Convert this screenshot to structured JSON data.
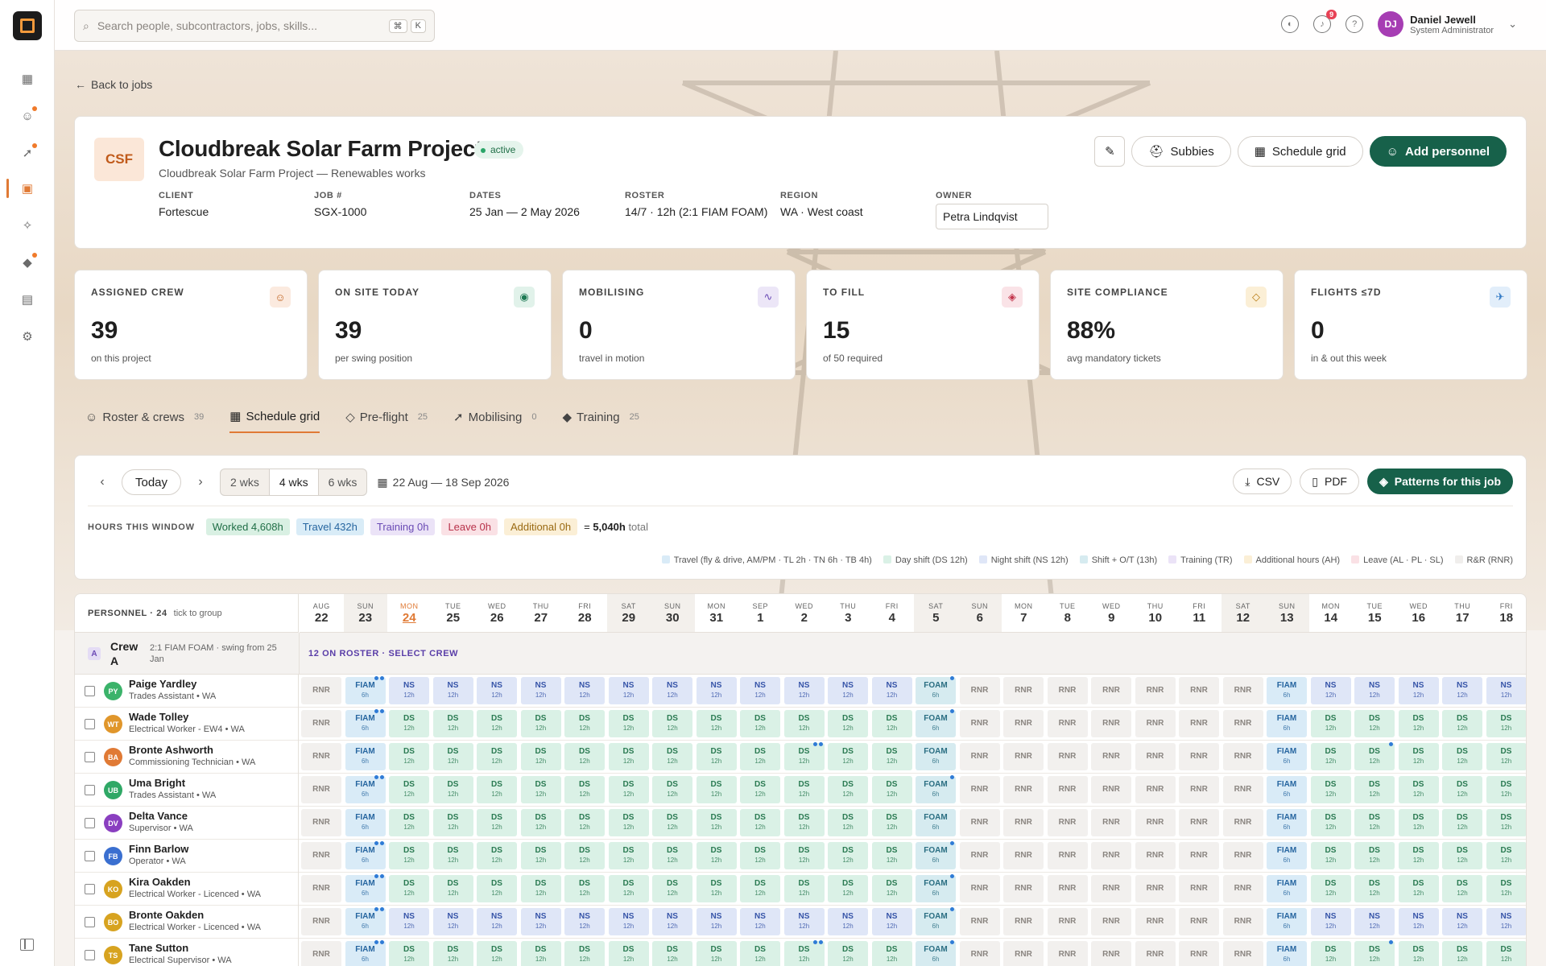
{
  "search": {
    "placeholder": "Search people, subcontractors, jobs, skills...",
    "shortcut": [
      "⌘",
      "K"
    ]
  },
  "topbar": {
    "notifications_count": "9",
    "user": {
      "initials": "DJ",
      "name": "Daniel Jewell",
      "role": "System Administrator"
    }
  },
  "back_label": "Back to jobs",
  "job": {
    "code": "CSF",
    "title": "Cloudbreak Solar Farm Project",
    "status": "active",
    "subtitle": "Cloudbreak Solar Farm Project — Renewables works",
    "meta": [
      {
        "label": "CLIENT",
        "value": "Fortescue"
      },
      {
        "label": "JOB #",
        "value": "SGX-1000"
      },
      {
        "label": "DATES",
        "value": "25 Jan — 2 May 2026"
      },
      {
        "label": "ROSTER",
        "value": "14/7 · 12h (2:1 FIAM FOAM)"
      },
      {
        "label": "REGION",
        "value": "WA · West coast"
      }
    ],
    "owner_label": "OWNER",
    "owner_value": "Petra Lindqvist",
    "buttons": {
      "subbies": "Subbies",
      "schedule": "Schedule grid",
      "add": "Add personnel"
    }
  },
  "stats": [
    {
      "label": "ASSIGNED CREW",
      "value": "39",
      "sub": "on this project",
      "icon": "users-icon",
      "color": "#c0621f",
      "bg": "#fbeadf"
    },
    {
      "label": "ON SITE TODAY",
      "value": "39",
      "sub": "per swing position",
      "icon": "pin-icon",
      "color": "#1f7a55",
      "bg": "#e1f2ea"
    },
    {
      "label": "MOBILISING",
      "value": "0",
      "sub": "travel in motion",
      "icon": "activity-icon",
      "color": "#6a4bb5",
      "bg": "#ece6f7"
    },
    {
      "label": "TO FILL",
      "value": "15",
      "sub": "of 50 required",
      "icon": "layers-icon",
      "color": "#c2334a",
      "bg": "#fae3e7"
    },
    {
      "label": "SITE COMPLIANCE",
      "value": "88%",
      "sub": "avg mandatory tickets",
      "icon": "shield-icon",
      "color": "#b77b12",
      "bg": "#fbefd6"
    },
    {
      "label": "FLIGHTS ≤7D",
      "value": "0",
      "sub": "in & out this week",
      "icon": "plane-icon",
      "color": "#2f78c4",
      "bg": "#e2eefa"
    }
  ],
  "tabs": [
    {
      "label": "Roster & crews",
      "count": "39"
    },
    {
      "label": "Schedule grid",
      "count": ""
    },
    {
      "label": "Pre-flight",
      "count": "25"
    },
    {
      "label": "Mobilising",
      "count": "0"
    },
    {
      "label": "Training",
      "count": "25"
    }
  ],
  "grid_controls": {
    "today": "Today",
    "ranges": [
      "2 wks",
      "4 wks",
      "6 wks"
    ],
    "active_range": "4 wks",
    "date_range": "22 Aug — 18 Sep 2026",
    "csv": "CSV",
    "pdf": "PDF",
    "patterns": "Patterns for this job"
  },
  "hours": {
    "label": "HOURS THIS WINDOW",
    "chips": [
      {
        "text": "Worked 4,608h",
        "bg": "#d9f0e3",
        "color": "#1f6e46"
      },
      {
        "text": "Travel 432h",
        "bg": "#d9ecf7",
        "color": "#2766a0"
      },
      {
        "text": "Training 0h",
        "bg": "#ebe3f7",
        "color": "#6a4bb5"
      },
      {
        "text": "Leave 0h",
        "bg": "#fae1e5",
        "color": "#b8324a"
      },
      {
        "text": "Additional 0h",
        "bg": "#fbefd6",
        "color": "#9a6a12"
      }
    ],
    "total": "5,040h",
    "total_suffix": "total"
  },
  "legend": [
    {
      "text": "Travel (fly & drive, AM/PM · TL 2h · TN 6h · TB 4h)",
      "color": "#d9ebf7"
    },
    {
      "text": "Day shift (DS 12h)",
      "color": "#daf1e6"
    },
    {
      "text": "Night shift (NS 12h)",
      "color": "#dfe6f7"
    },
    {
      "text": "Shift + O/T (13h)",
      "color": "#d6ebf0"
    },
    {
      "text": "Training (TR)",
      "color": "#ebe3f7"
    },
    {
      "text": "Additional hours (AH)",
      "color": "#fbefd6"
    },
    {
      "text": "Leave (AL · PL · SL)",
      "color": "#fae1e5"
    },
    {
      "text": "R&R (RNR)",
      "color": "#f0eeec"
    }
  ],
  "schedule": {
    "personnel_label": "PERSONNEL · 24",
    "group_hint": "tick to group",
    "days": [
      {
        "w": "AUG",
        "d": "22"
      },
      {
        "w": "SUN",
        "d": "23"
      },
      {
        "w": "MON",
        "d": "24"
      },
      {
        "w": "TUE",
        "d": "25"
      },
      {
        "w": "WED",
        "d": "26"
      },
      {
        "w": "THU",
        "d": "27"
      },
      {
        "w": "FRI",
        "d": "28"
      },
      {
        "w": "SAT",
        "d": "29"
      },
      {
        "w": "SUN",
        "d": "30"
      },
      {
        "w": "MON",
        "d": "31"
      },
      {
        "w": "SEP",
        "d": "1"
      },
      {
        "w": "WED",
        "d": "2"
      },
      {
        "w": "THU",
        "d": "3"
      },
      {
        "w": "FRI",
        "d": "4"
      },
      {
        "w": "SAT",
        "d": "5"
      },
      {
        "w": "SUN",
        "d": "6"
      },
      {
        "w": "MON",
        "d": "7"
      },
      {
        "w": "TUE",
        "d": "8"
      },
      {
        "w": "WED",
        "d": "9"
      },
      {
        "w": "THU",
        "d": "10"
      },
      {
        "w": "FRI",
        "d": "11"
      },
      {
        "w": "SAT",
        "d": "12"
      },
      {
        "w": "SUN",
        "d": "13"
      },
      {
        "w": "MON",
        "d": "14"
      },
      {
        "w": "TUE",
        "d": "15"
      },
      {
        "w": "WED",
        "d": "16"
      },
      {
        "w": "THU",
        "d": "17"
      },
      {
        "w": "FRI",
        "d": "18"
      }
    ],
    "crew": {
      "tag": "A",
      "name": "Crew A",
      "desc": "2:1 FIAM FOAM · swing from 25 Jan",
      "select": "12 ON ROSTER · SELECT CREW"
    },
    "people": [
      {
        "initials": "PY",
        "name": "Paige Yardley",
        "role": "Trades Assistant • WA",
        "color": "#3bb36a",
        "pattern": "ns"
      },
      {
        "initials": "WT",
        "name": "Wade Tolley",
        "role": "Electrical Worker - EW4 • WA",
        "color": "#e0962b",
        "pattern": "ds"
      },
      {
        "initials": "BA",
        "name": "Bronte Ashworth",
        "role": "Commissioning Technician • WA",
        "color": "#e07a35",
        "pattern": "ds"
      },
      {
        "initials": "UB",
        "name": "Uma Bright",
        "role": "Trades Assistant • WA",
        "color": "#2fa866",
        "pattern": "ds"
      },
      {
        "initials": "DV",
        "name": "Delta Vance",
        "role": "Supervisor • WA",
        "color": "#8a3fc0",
        "pattern": "ds"
      },
      {
        "initials": "FB",
        "name": "Finn Barlow",
        "role": "Operator • WA",
        "color": "#3a6fd0",
        "pattern": "ds"
      },
      {
        "initials": "KO",
        "name": "Kira Oakden",
        "role": "Electrical Worker - Licenced • WA",
        "color": "#d7a320",
        "pattern": "ds"
      },
      {
        "initials": "BO",
        "name": "Bronte Oakden",
        "role": "Electrical Worker - Licenced • WA",
        "color": "#d7a320",
        "pattern": "ns"
      },
      {
        "initials": "TS",
        "name": "Tane Sutton",
        "role": "Electrical Supervisor • WA",
        "color": "#d7a320",
        "pattern": "ds"
      }
    ],
    "cell_text": {
      "rnr": "RNR",
      "fiam": "FIAM",
      "foam": "FOAM",
      "ds": "DS",
      "ns": "NS",
      "h6": "6h",
      "h12": "12h"
    }
  }
}
